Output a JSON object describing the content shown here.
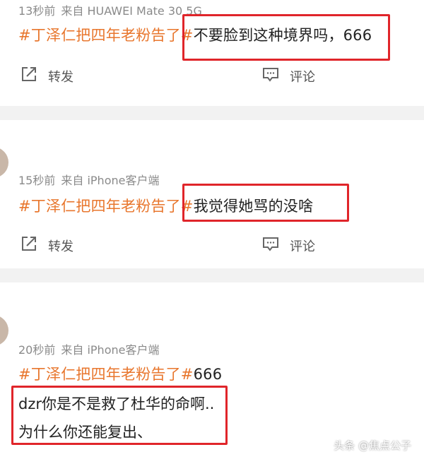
{
  "posts": [
    {
      "time": "13秒前",
      "source": "来自 HUAWEI Mate 30 5G",
      "hashtag": "#丁泽仁把四年老粉告了#",
      "text": "不要脸到这种境界吗，666",
      "repost_label": "转发",
      "comment_label": "评论"
    },
    {
      "time": "15秒前",
      "source": "来自 iPhone客户端",
      "hashtag": "#丁泽仁把四年老粉告了#",
      "text": "我觉得她骂的没啥",
      "repost_label": "转发",
      "comment_label": "评论"
    },
    {
      "time": "20秒前",
      "source": "来自 iPhone客户端",
      "hashtag": "#丁泽仁把四年老粉告了#",
      "text": "666",
      "text_line2": "dzr你是不是救了杜华的命啊..",
      "text_line3": "为什么你还能复出、"
    }
  ],
  "watermark": "头条 @焦点公子",
  "colors": {
    "hashtag": "#e8762d",
    "highlight_box": "#e0252a",
    "meta": "#8a8a8a",
    "divider": "#f2f2f2"
  },
  "icons": [
    "repost-icon",
    "comment-icon"
  ]
}
